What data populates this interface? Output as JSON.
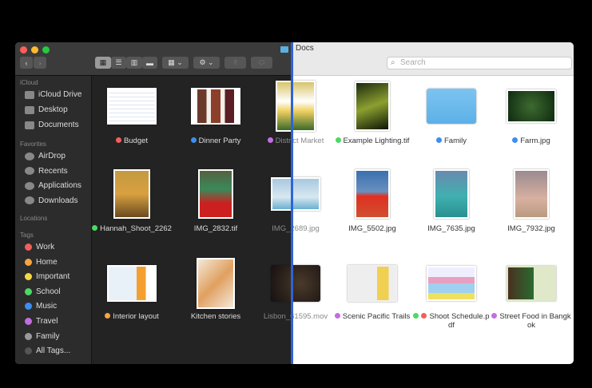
{
  "window": {
    "folder_title": "Docs"
  },
  "toolbar": {
    "back": "‹",
    "forward": "›",
    "search_placeholder": "Search"
  },
  "sidebar": {
    "icloud_heading": "iCloud",
    "icloud": [
      {
        "label": "iCloud Drive",
        "icon": "cloud-icon"
      },
      {
        "label": "Desktop",
        "icon": "desktop-icon"
      },
      {
        "label": "Documents",
        "icon": "document-icon"
      }
    ],
    "favorites_heading": "Favorites",
    "favorites": [
      {
        "label": "AirDrop",
        "icon": "airdrop-icon"
      },
      {
        "label": "Recents",
        "icon": "clock-icon"
      },
      {
        "label": "Applications",
        "icon": "applications-icon"
      },
      {
        "label": "Downloads",
        "icon": "download-icon"
      }
    ],
    "locations_heading": "Locations",
    "tags_heading": "Tags",
    "tags": [
      {
        "label": "Work",
        "color": "#f25f5c"
      },
      {
        "label": "Home",
        "color": "#f7a541"
      },
      {
        "label": "Important",
        "color": "#f5d742"
      },
      {
        "label": "School",
        "color": "#4cd964"
      },
      {
        "label": "Music",
        "color": "#3d8ef0"
      },
      {
        "label": "Travel",
        "color": "#c26ee0"
      },
      {
        "label": "Family",
        "color": "#9a9a9a"
      },
      {
        "label": "All Tags...",
        "color": "#555555"
      }
    ]
  },
  "files": [
    {
      "name": "Budget",
      "tags": [
        "#f25f5c"
      ]
    },
    {
      "name": "Dinner Party",
      "tags": [
        "#3d8ef0"
      ]
    },
    {
      "name": "District Market",
      "tags": [
        "#c26ee0"
      ]
    },
    {
      "name": "Example Lighting.tif",
      "tags": [
        "#4cd964"
      ]
    },
    {
      "name": "Family",
      "tags": [
        "#3d8ef0"
      ]
    },
    {
      "name": "Farm.jpg",
      "tags": [
        "#3d8ef0"
      ]
    },
    {
      "name": "Hannah_Shoot_2262",
      "tags": [
        "#4cd964"
      ]
    },
    {
      "name": "IMG_2832.tif",
      "tags": []
    },
    {
      "name": "IMG_2689.jpg",
      "tags": []
    },
    {
      "name": "IMG_5502.jpg",
      "tags": []
    },
    {
      "name": "IMG_7635.jpg",
      "tags": []
    },
    {
      "name": "IMG_7932.jpg",
      "tags": []
    },
    {
      "name": "Interior layout",
      "tags": [
        "#f7a541"
      ]
    },
    {
      "name": "Kitchen stories",
      "tags": []
    },
    {
      "name": "Lisbon_61595.mov",
      "tags": []
    },
    {
      "name": "Scenic Pacific Trails",
      "tags": [
        "#c26ee0"
      ]
    },
    {
      "name": "Shoot Schedule.pdf",
      "tags": [
        "#4cd964",
        "#f25f5c"
      ]
    },
    {
      "name": "Street Food in Bangkok",
      "tags": [
        "#c26ee0"
      ]
    }
  ]
}
